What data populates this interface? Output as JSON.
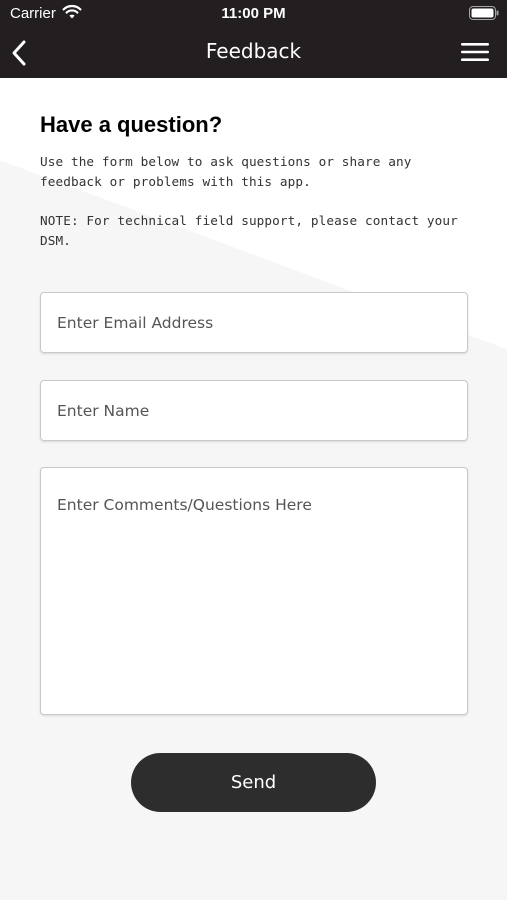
{
  "status_bar": {
    "carrier": "Carrier",
    "time": "11:00 PM"
  },
  "nav": {
    "title": "Feedback",
    "back_icon": "chevron-left-icon",
    "menu_icon": "hamburger-menu-icon"
  },
  "content": {
    "title": "Have a question?",
    "intro": "Use the form below to ask questions or share any feedback or problems with this app.",
    "note": "NOTE: For technical field support, please contact your DSM."
  },
  "form": {
    "email_placeholder": "Enter Email Address",
    "name_placeholder": "Enter Name",
    "comments_placeholder": "Enter Comments/Questions Here",
    "send_label": "Send"
  },
  "colors": {
    "header": "#231f20",
    "button": "#2d2d2d",
    "background": "#f6f6f6"
  }
}
